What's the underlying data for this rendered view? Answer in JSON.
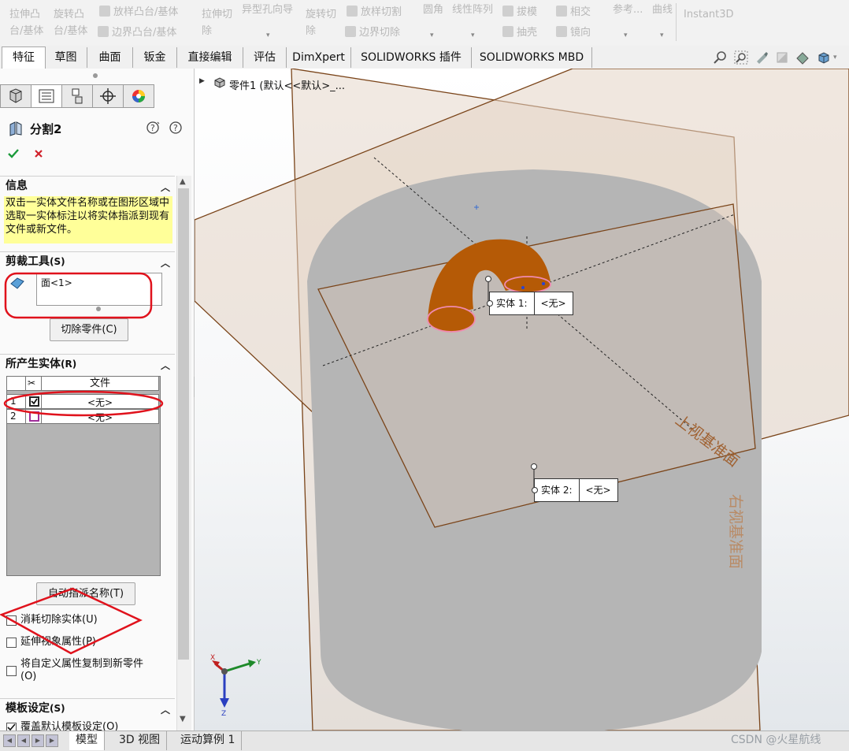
{
  "ribbon": {
    "extrude_boss": "拉伸凸\n台/基体",
    "revolve_boss": "旋转凸\n台/基体",
    "loft_boss": "放样凸台/基体",
    "boundary_boss": "边界凸台/基体",
    "extrude_cut": "拉伸切\n除",
    "hole_wizard": "异型孔向导",
    "revolve_cut": "旋转切\n除",
    "loft_cut": "放样切割",
    "boundary_cut": "边界切除",
    "fillet": "圆角",
    "linear_pattern": "线性阵列",
    "draft": "拔模",
    "intersect": "相交",
    "shell": "抽壳",
    "mirror": "镜向",
    "reference": "参考...",
    "curves": "曲线",
    "instant3d": "Instant3D"
  },
  "tabs": [
    "特征",
    "草图",
    "曲面",
    "钣金",
    "直接编辑",
    "评估",
    "DimXpert",
    "SOLIDWORKS 插件",
    "SOLIDWORKS MBD"
  ],
  "panel": {
    "title": "分割2",
    "info_header": "信息",
    "info_text": "双击一实体文件名称或在图形区域中选取一实体标注以将实体指派到现有文件或新文件。",
    "trim_header": "剪裁工具",
    "trim_hotkey": "(S)",
    "trim_value": "面<1>",
    "cut_part_button": "切除零件(C)",
    "bodies_header": "所产生实体",
    "bodies_hotkey": "(R)",
    "table_col_file": "文件",
    "rows": [
      {
        "num": "1",
        "checked": true,
        "file": "<无>"
      },
      {
        "num": "2",
        "checked": false,
        "file": "<无>"
      }
    ],
    "auto_assign_button": "自动指派名称(T)",
    "consume_label": "消耗切除实体(U)",
    "propagate_label": "延伸视象属性(P)",
    "copy_props_label": "将自定义属性复制到新零件(O)",
    "template_header": "模板设定",
    "template_hotkey": "(S)",
    "override_label": "覆盖默认模板设定(O)"
  },
  "viewport": {
    "tree_item": "零件1  (默认<<默认>_...",
    "callout1_label": "实体  1:",
    "callout1_value": "<无>",
    "callout2_label": "实体  2:",
    "callout2_value": "<无>",
    "top_plane_label": "上视基准面",
    "right_plane_label": "右视基准面",
    "triad_x": "X",
    "triad_y": "Y",
    "triad_z": "Z"
  },
  "bottom_tabs": [
    "模型",
    "3D 视图",
    "运动算例 1"
  ],
  "watermark": "CSDN @火星航线",
  "colors": {
    "annotation_red": "#e0121c",
    "torus": "#b55a06",
    "cylinder": "#b5b5b5",
    "plane_edge": "#7a4419",
    "info_bg": "#ffff99"
  }
}
